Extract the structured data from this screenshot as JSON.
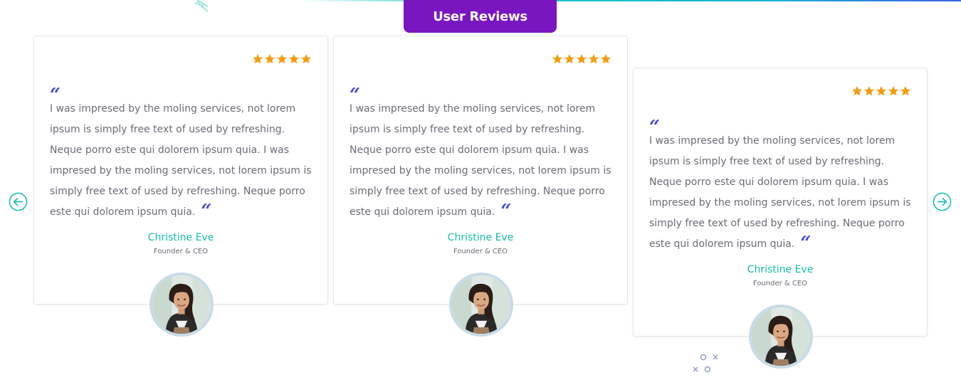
{
  "section": {
    "title": "User Reviews"
  },
  "colors": {
    "accent_purple": "#7a16c0",
    "name_teal": "#13bfa6",
    "star_orange": "#f39c12",
    "quote_blue": "#4a4fd8",
    "arrow_teal": "#19bfb0"
  },
  "navigation": {
    "prev_icon": "arrow-left-circle-icon",
    "next_icon": "arrow-right-circle-icon"
  },
  "reviews": [
    {
      "rating": 5,
      "text": "I was impresed by the moling services, not lorem ipsum is simply free text of used by refreshing. Neque porro este qui dolorem ipsum quia. I was impresed by the moling services, not lorem ipsum is simply free text of used by refreshing. Neque porro este qui dolorem ipsum quia.",
      "author": "Christine Eve",
      "role": "Founder & CEO"
    },
    {
      "rating": 5,
      "text": "I was impresed by the moling services, not lorem ipsum is simply free text of used by refreshing. Neque porro este qui dolorem ipsum quia. I was impresed by the moling services, not lorem ipsum is simply free text of used by refreshing. Neque porro este qui dolorem ipsum quia.",
      "author": "Christine Eve",
      "role": "Founder & CEO"
    },
    {
      "rating": 5,
      "text": "I was impresed by the moling services, not lorem ipsum is simply free text of used by refreshing. Neque porro este qui dolorem ipsum quia. I was impresed by the moling services, not lorem ipsum is simply free text of used by refreshing. Neque porro este qui dolorem ipsum quia.",
      "author": "Christine Eve",
      "role": "Founder & CEO"
    }
  ]
}
